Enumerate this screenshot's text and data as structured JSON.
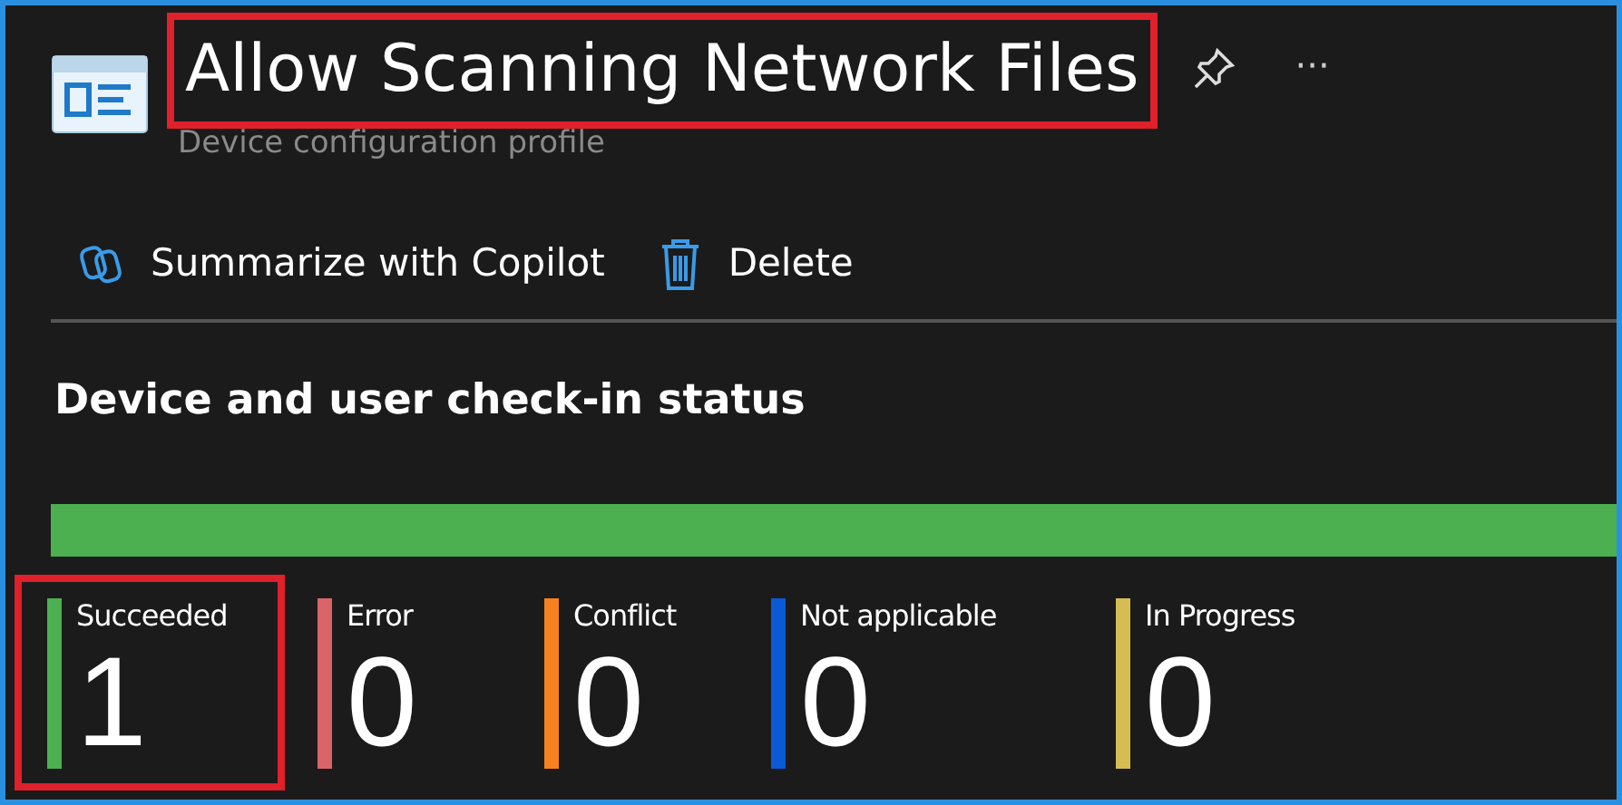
{
  "header": {
    "title": "Allow Scanning Network Files",
    "title_highlighted": true,
    "subtitle": "Device configuration profile",
    "more_label": "···"
  },
  "toolbar": [
    {
      "kind": "copilot",
      "label": "Summarize with Copilot"
    },
    {
      "kind": "delete",
      "label": "Delete"
    }
  ],
  "section": {
    "title": "Device and user check-in status",
    "bar": {
      "level": 1,
      "color": "#4caf50"
    }
  },
  "statuses": [
    {
      "label": "Succeeded",
      "count": "1",
      "color": "#4caf50",
      "highlighted": true
    },
    {
      "label": "Error",
      "count": "0",
      "color": "#d9646a",
      "highlighted": false
    },
    {
      "label": "Conflict",
      "count": "0",
      "color": "#f7811f",
      "highlighted": false
    },
    {
      "label": "Not applicable",
      "count": "0",
      "color": "#0a5ad6",
      "highlighted": false
    },
    {
      "label": "In Progress",
      "count": "0",
      "color": "#d6bd52",
      "highlighted": false
    }
  ]
}
